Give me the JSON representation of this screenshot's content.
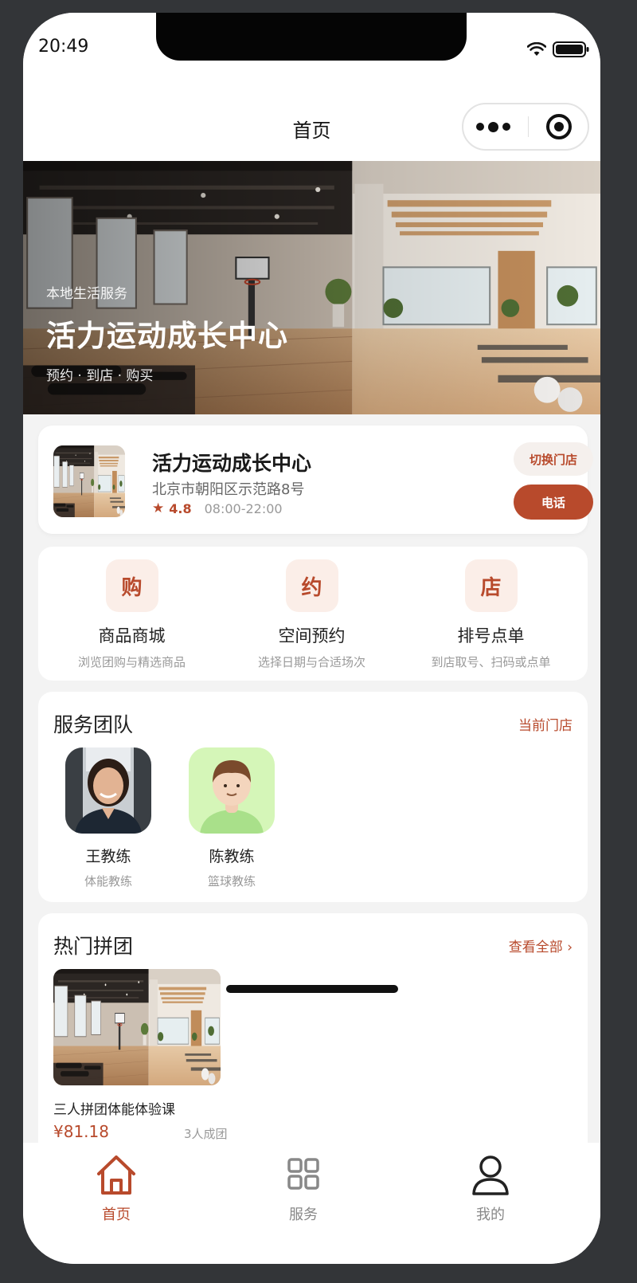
{
  "status_bar": {
    "time": "20:49"
  },
  "navbar": {
    "title": "首页"
  },
  "hero": {
    "subtitle": "本地生活服务",
    "title": "活力运动成长中心",
    "tags": "预约 · 到店 · 购买"
  },
  "store": {
    "name": "活力运动成长中心",
    "address": "北京市朝阳区示范路8号",
    "rating": "4.8",
    "hours": "08:00-22:00",
    "switch_label": "切换门店",
    "call_label": "电话"
  },
  "services": [
    {
      "badge": "购",
      "name": "商品商城",
      "desc": "浏览团购与精选商品"
    },
    {
      "badge": "约",
      "name": "空间预约",
      "desc": "选择日期与合适场次"
    },
    {
      "badge": "店",
      "name": "排号点单",
      "desc": "到店取号、扫码或点单"
    }
  ],
  "team": {
    "title": "服务团队",
    "link": "当前门店",
    "coaches": [
      {
        "name": "王教练",
        "role": "体能教练"
      },
      {
        "name": "陈教练",
        "role": "篮球教练"
      }
    ]
  },
  "group_buy": {
    "title": "热门拼团",
    "link": "查看全部 ›",
    "items": [
      {
        "name": "三人拼团体能体验课",
        "price": "¥81.18",
        "note": "3人成团"
      }
    ]
  },
  "tabbar": {
    "items": [
      {
        "label": "首页",
        "icon": "home-icon",
        "active": true
      },
      {
        "label": "服务",
        "icon": "grid-icon",
        "active": false
      },
      {
        "label": "我的",
        "icon": "user-icon",
        "active": false
      }
    ]
  },
  "colors": {
    "accent": "#b84a2c",
    "accent_soft": "#fbeee8",
    "background": "#f3f3f3"
  }
}
